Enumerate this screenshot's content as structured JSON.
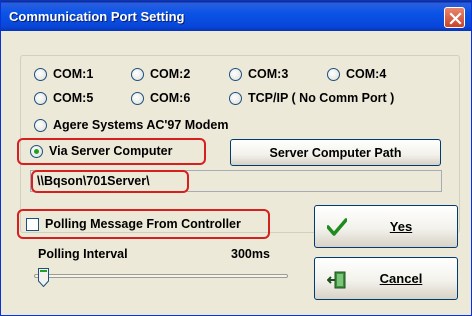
{
  "window": {
    "title": "Communication Port Setting"
  },
  "ports": {
    "com1": "COM:1",
    "com2": "COM:2",
    "com3": "COM:3",
    "com4": "COM:4",
    "com5": "COM:5",
    "com6": "COM:6",
    "tcpip": "TCP/IP ( No Comm Port )",
    "modem": "Agere Systems AC'97 Modem",
    "server": "Via Server Computer",
    "selected": "Via Server Computer"
  },
  "server_path": {
    "button_label": "Server Computer Path",
    "value": "\\\\Bqson\\701Server\\"
  },
  "polling": {
    "checkbox_label": "Polling Message From Controller",
    "checked": false,
    "interval_label": "Polling Interval",
    "interval_value": "300ms"
  },
  "buttons": {
    "yes": "Yes",
    "cancel": "Cancel"
  },
  "colors": {
    "titlebar": "#0A54E6",
    "highlight": "#D62020",
    "check": "#21A121"
  }
}
